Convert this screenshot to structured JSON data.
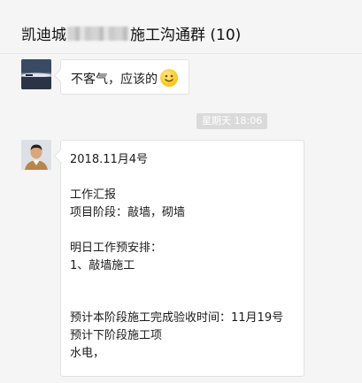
{
  "header": {
    "title_prefix": "凯迪城",
    "title_suffix": "施工沟通群 (10)"
  },
  "messages": [
    {
      "text": "不客气，应该的",
      "emoji": "smile-emoji"
    }
  ],
  "timestamp": "星期天 18:06",
  "report": {
    "lines": [
      "2018.11月4号",
      "工作汇报",
      "项目阶段：敲墙，砌墙",
      "明日工作预安排：",
      "1、敲墙施工",
      "预计本阶段施工完成验收时间：11月19号",
      "预计下阶段施工项",
      "水电，"
    ]
  },
  "colors": {
    "background": "#f5f5f5",
    "bubble": "#ffffff",
    "timestamp_bg": "#dadada"
  }
}
